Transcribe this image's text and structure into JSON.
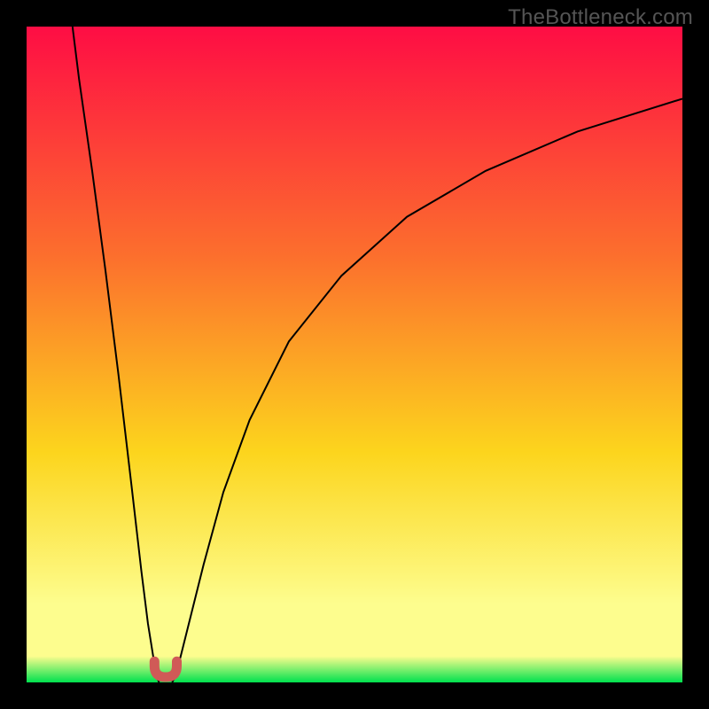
{
  "watermark": "TheBottleneck.com",
  "colors": {
    "gradient_top": "#fe0d44",
    "gradient_mid1": "#fc6f2d",
    "gradient_mid2": "#fcd51d",
    "gradient_mid3": "#fdfd8e",
    "gradient_bottom": "#00e14e",
    "frame": "#000000",
    "curve": "#000000",
    "marker": "#d05a57"
  },
  "chart_data": {
    "type": "line",
    "title": "",
    "xlabel": "",
    "ylabel": "",
    "xlim": [
      0,
      100
    ],
    "ylim": [
      0,
      100
    ],
    "grid": false,
    "legend": false,
    "series": [
      {
        "name": "left-branch",
        "x": [
          7,
          8,
          10,
          12,
          14,
          16,
          17.5,
          18.5,
          19.3,
          19.8,
          20.2
        ],
        "values": [
          100,
          92,
          78,
          63,
          47,
          30,
          17,
          9,
          4,
          1,
          0
        ]
      },
      {
        "name": "right-branch",
        "x": [
          22.2,
          22.7,
          23.5,
          25,
          27,
          30,
          34,
          40,
          48,
          58,
          70,
          84,
          100
        ],
        "values": [
          0,
          1,
          4,
          10,
          18,
          29,
          40,
          52,
          62,
          71,
          78,
          84,
          89
        ]
      }
    ],
    "annotations": [
      {
        "name": "u-marker",
        "shape": "u",
        "x_center": 21.2,
        "y_bottom": 0,
        "width": 3.4,
        "height": 3.2
      }
    ]
  }
}
